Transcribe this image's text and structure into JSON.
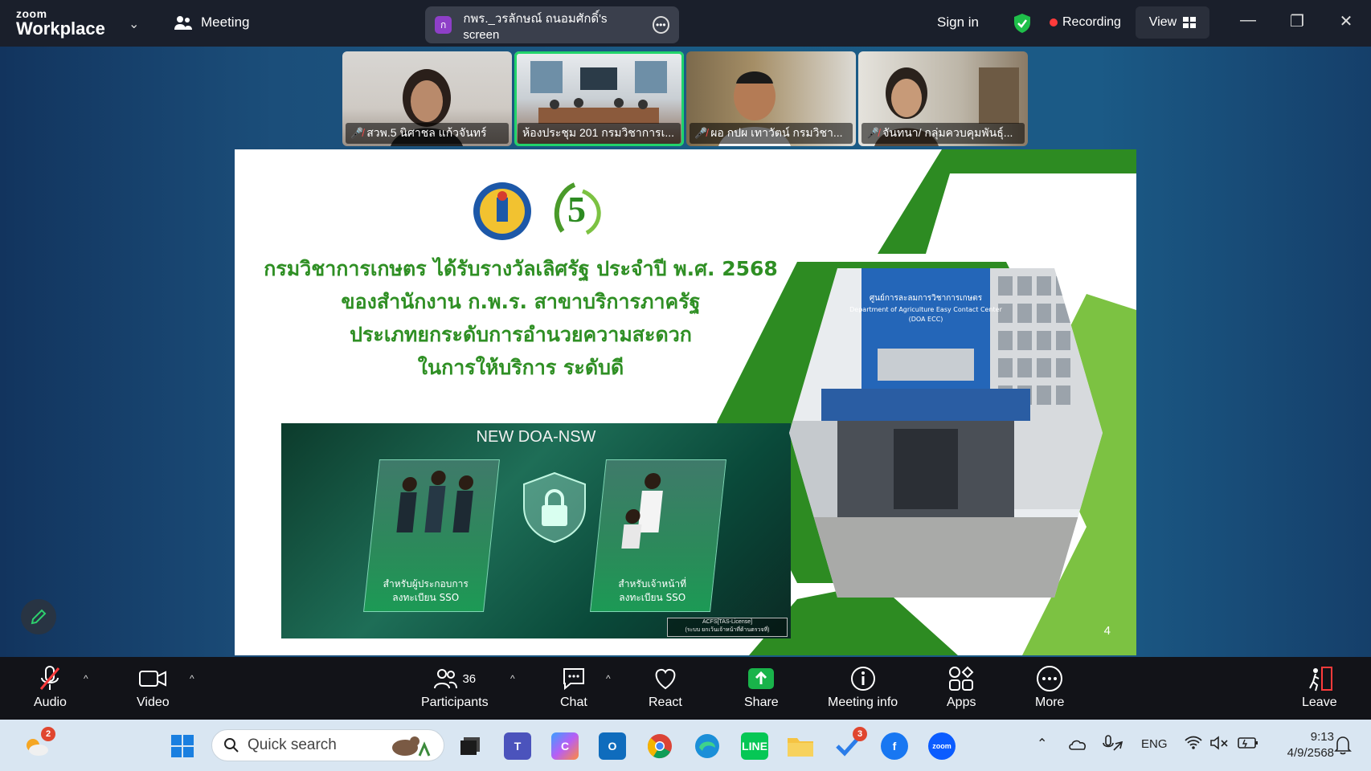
{
  "titlebar": {
    "brand_top": "zoom",
    "brand_bottom": "Workplace",
    "meeting_label": "Meeting",
    "share_initial": "ก",
    "share_text": "กพร._วรลักษณ์ ถนอมศักดิ์'s screen",
    "sign_in": "Sign in",
    "recording": "Recording",
    "view": "View"
  },
  "thumbnails": [
    {
      "name": "สวพ.5 นิศาชล แก้วจันทร์",
      "muted": true
    },
    {
      "name": "ห้องประชุม 201 กรมวิชาการเ...",
      "muted": false,
      "active": true
    },
    {
      "name": "ผอ กปผ เทาวัตน์ กรมวิชา...",
      "muted": true
    },
    {
      "name": "จันทนา/ กลุ่มควบคุมพันธุ์...",
      "muted": true
    }
  ],
  "slide": {
    "title_lines": [
      "กรมวิชาการเกษตร ได้รับรางวัลเลิศรัฐ ประจำปี พ.ศ. 2568",
      "ของสำนักงาน ก.พ.ร. สาขาบริการภาครัฐ",
      "ประเภทยกระดับการอำนวยความสะดวก",
      "ในการให้บริการ ระดับดี"
    ],
    "banner_title": "NEW DOA-NSW",
    "card_left_line1": "สำหรับผู้ประกอบการ",
    "card_left_line2": "ลงทะเบียน SSO",
    "card_right_line1": "สำหรับเจ้าหน้าที่",
    "card_right_line2": "ลงทะเบียน SSO",
    "small_box_line1": "ACFS[TAS-License]",
    "small_box_line2": "(ระบบ ยกเว้นเจ้าหน้าที่ด้านตรวจที่)",
    "building_sign_line1": "ศูนย์การละลมการวิชาการเกษตร",
    "building_sign_line2": "Department of Agriculture Easy Contact Center",
    "building_sign_line3": "(DOA ECC)",
    "logo_number": "5",
    "page_number": "4"
  },
  "toolbar": {
    "audio": "Audio",
    "video": "Video",
    "participants": "Participants",
    "participants_count": "36",
    "chat": "Chat",
    "react": "React",
    "share": "Share",
    "meeting_info": "Meeting info",
    "apps": "Apps",
    "more": "More",
    "leave": "Leave"
  },
  "taskbar": {
    "weather_badge": "2",
    "search_placeholder": "Quick search",
    "todo_badge": "3",
    "language": "ENG",
    "time": "9:13",
    "date": "4/9/2568"
  },
  "colors": {
    "slide_green": "#2f8f24",
    "active_border": "#21d36b",
    "share_green": "#19b34a",
    "record_red": "#ff3b3b"
  }
}
